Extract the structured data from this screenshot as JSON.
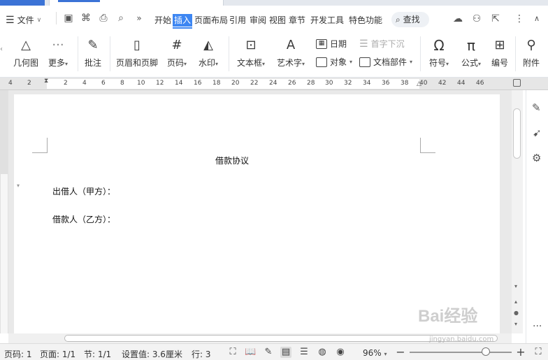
{
  "menubar": {
    "file_label": "文件",
    "tabs": [
      "开始",
      "插入",
      "页面布局",
      "引用",
      "审阅",
      "视图",
      "章节",
      "开发工具",
      "特色功能"
    ],
    "active_tab": "插入",
    "search_label": "查找",
    "accent_color": "#3d86f2"
  },
  "toolbar": {
    "geometry": "几何图",
    "more": "更多",
    "comment": "批注",
    "header_footer": "页眉和页脚",
    "page_number": "页码",
    "watermark": "水印",
    "textbox": "文本框",
    "wordart": "艺术字",
    "date": "日期",
    "object": "对象",
    "dropcap": "首字下沉",
    "doc_parts": "文档部件",
    "symbol": "符号",
    "formula": "公式",
    "numbering": "编号",
    "attachment": "附件"
  },
  "ruler": {
    "ticks": [
      "4",
      "2",
      "2",
      "4",
      "6",
      "8",
      "10",
      "12",
      "14",
      "16",
      "18",
      "20",
      "22",
      "24",
      "26",
      "28",
      "30",
      "32",
      "34",
      "36",
      "38",
      "40",
      "42",
      "44",
      "46"
    ]
  },
  "document": {
    "title": "借款协议",
    "lender": "出借人（甲方）：",
    "borrower": "借款人（乙方）："
  },
  "statusbar": {
    "page_num": "页码: 1",
    "pages": "页面: 1/1",
    "section": "节: 1/1",
    "setting": "设置值: 3.6厘米",
    "line": "行: 3",
    "zoom": "96%",
    "zoom_level": 0.96
  },
  "watermark": {
    "brand": "Bai经验",
    "url": "jingyan.baidu.com"
  }
}
